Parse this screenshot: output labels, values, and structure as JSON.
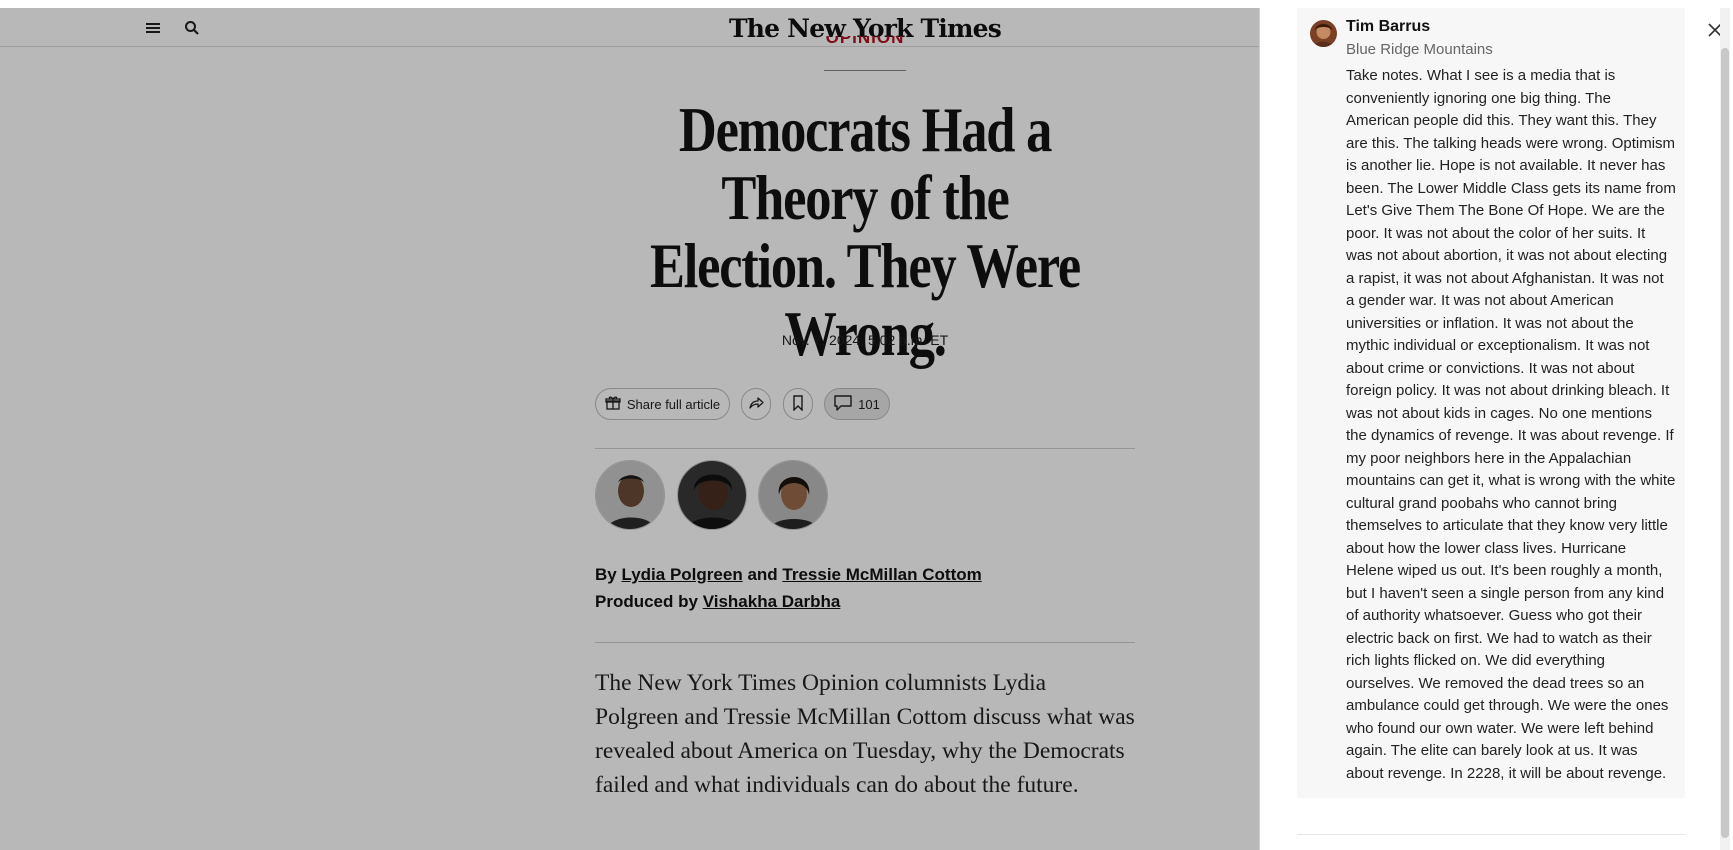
{
  "header": {
    "masthead": "The New York Times",
    "menu_icon": "hamburger-menu-icon",
    "search_icon": "search-icon"
  },
  "article": {
    "section_label": "OPINION",
    "headline": "Democrats Had a Theory of the Election. They Were Wrong.",
    "dateline": "Nov. 7, 2024, 5:02 a.m. ET",
    "share_label": "Share full article",
    "comment_count": "101",
    "byline_prefix": "By",
    "author_1": "Lydia Polgreen",
    "byline_and": "and",
    "author_2": "Tressie McMillan Cottom",
    "producer_prefix": "Produced by",
    "producer": "Vishakha Darbha",
    "summary": "The New York Times Opinion columnists Lydia Polgreen and Tressie McMillan Cottom discuss what was revealed about America on Tuesday, why the Democrats failed and what individuals can do about the future."
  },
  "comment": {
    "author": "Tim Barrus",
    "location": "Blue Ridge Mountains",
    "text": "Take notes. What I see is a media that is conveniently ignoring one big thing. The American people did this. They want this. They are this. The talking heads were wrong. Optimism is another lie. Hope is not available. It never has been. The Lower Middle Class gets its name from Let's Give Them The Bone Of Hope. We are the poor. It was not about the color of her suits. It was not about abortion, it was not about electing a rapist, it was not about Afghanistan. It was not a gender war. It was not about American universities or inflation. It was not about the mythic individual or exceptionalism. It was not about crime or convictions. It was not about foreign policy. It was not about drinking bleach. It was not about kids in cages. No one mentions the dynamics of revenge. It was about revenge. If my poor neighbors here in the Appalachian mountains can get it, what is wrong with the white cultural grand poobahs who cannot bring themselves to articulate that they know very little about how the lower class lives. Hurricane Helene wiped us out. It's been roughly a month, but I haven't seen a single person from any kind of authority whatsoever. Guess who got their electric back on first. We had to watch as their rich lights flicked on. We did everything ourselves. We removed the dead trees so an ambulance could get through. We were the ones who found our own water. We were left behind again. The elite can barely look at us. It was about revenge. In 2228, it will be about revenge."
  },
  "colors": {
    "section_red": "#b0111f",
    "overlay": "rgba(0,0,0,0.28)"
  }
}
